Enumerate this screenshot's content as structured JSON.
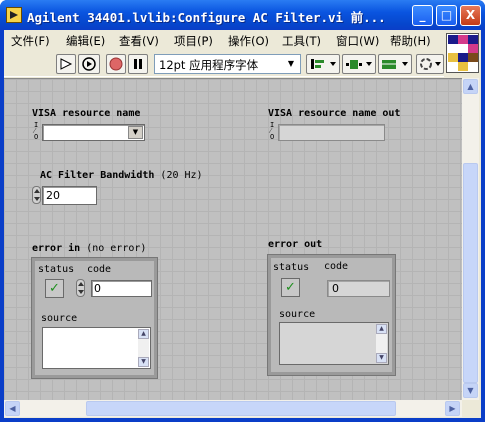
{
  "window": {
    "title": "Agilent 34401.lvlib:Configure AC Filter.vi 前...",
    "buttons": {
      "minimize": "_",
      "maximize": "□",
      "close": "X"
    }
  },
  "menu": [
    "文件(F)",
    "编辑(E)",
    "查看(V)",
    "项目(P)",
    "操作(O)",
    "工具(T)",
    "窗口(W)",
    "帮助(H)"
  ],
  "toolbar": {
    "font": "12pt 应用程序字体",
    "run_icon": "run-arrow-icon",
    "run_continuous_icon": "run-continuously-icon",
    "abort_icon": "abort-icon",
    "pause_icon": "pause-icon"
  },
  "panel": {
    "visa_in": {
      "label": "VISA resource name",
      "value": "",
      "io_glyph": "I/O"
    },
    "visa_out": {
      "label": "VISA resource name out",
      "value": "",
      "io_glyph": "I/O"
    },
    "ac_filter": {
      "label": "AC Filter Bandwidth",
      "label_suffix": "(20 Hz)",
      "value": "20"
    },
    "error_in": {
      "label": "error in",
      "label_suffix": "(no error)",
      "status_label": "status",
      "code_label": "code",
      "source_label": "source",
      "status": "✓",
      "code": "0",
      "source": ""
    },
    "error_out": {
      "label": "error out",
      "status_label": "status",
      "code_label": "code",
      "source_label": "source",
      "status": "✓",
      "code": "0",
      "source": ""
    }
  },
  "colors": {
    "panel_bg": "#c0c0c0",
    "titlebar": "#0a55e0",
    "check": "#1f8f1f"
  }
}
